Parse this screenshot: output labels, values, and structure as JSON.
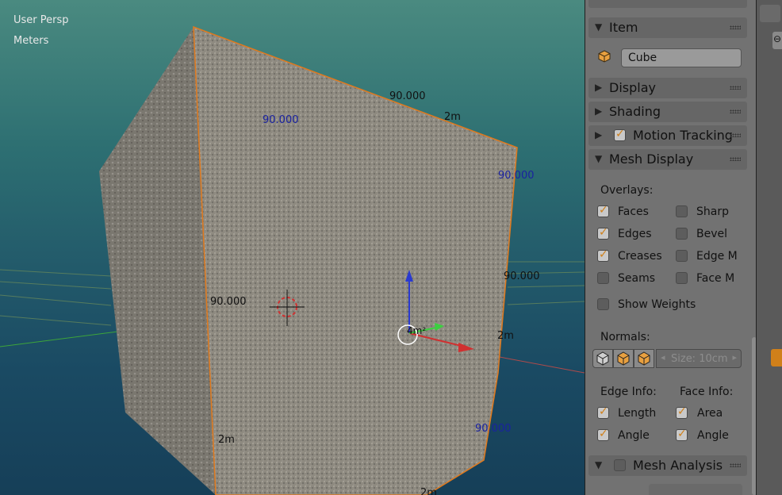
{
  "viewport": {
    "view_name": "User Persp",
    "units": "Meters",
    "edge_lengths": {
      "top_edge": "2m",
      "right_edge": "2m",
      "bottom_left_edge": "2m",
      "bottom_edge": "2m",
      "center": "4m²"
    },
    "angles_dark": [
      "90.000",
      "90.000",
      "90.000"
    ],
    "angles_blue": [
      "90.000",
      "90.000",
      "90.000"
    ]
  },
  "panel": {
    "item": {
      "header": "Item",
      "object_name": "Cube"
    },
    "display": {
      "header": "Display"
    },
    "shading": {
      "header": "Shading"
    },
    "motion_tracking": {
      "header": "Motion Tracking",
      "checked": true
    },
    "mesh_display": {
      "header": "Mesh Display",
      "overlays_label": "Overlays:",
      "overlays": [
        {
          "label": "Faces",
          "checked": true
        },
        {
          "label": "Sharp",
          "checked": false
        },
        {
          "label": "Edges",
          "checked": true
        },
        {
          "label": "Bevel",
          "checked": false
        },
        {
          "label": "Creases",
          "checked": true
        },
        {
          "label": "Edge M",
          "checked": false
        },
        {
          "label": "Seams",
          "checked": false
        },
        {
          "label": "Face M",
          "checked": false
        }
      ],
      "show_weights": {
        "label": "Show Weights",
        "checked": false
      },
      "normals_label": "Normals:",
      "normals_size": "Size: 10cm",
      "edge_info_label": "Edge Info:",
      "face_info_label": "Face Info:",
      "edge_info": [
        {
          "label": "Length",
          "checked": true
        },
        {
          "label": "Angle",
          "checked": true
        }
      ],
      "face_info": [
        {
          "label": "Area",
          "checked": true
        },
        {
          "label": "Angle",
          "checked": true
        }
      ]
    },
    "mesh_analysis": {
      "header": "Mesh Analysis",
      "checked": false
    }
  },
  "colors": {
    "selection": "#e07a1e",
    "checkbox_tick": "#d0801a",
    "accent_blue": "#1a22a0"
  }
}
